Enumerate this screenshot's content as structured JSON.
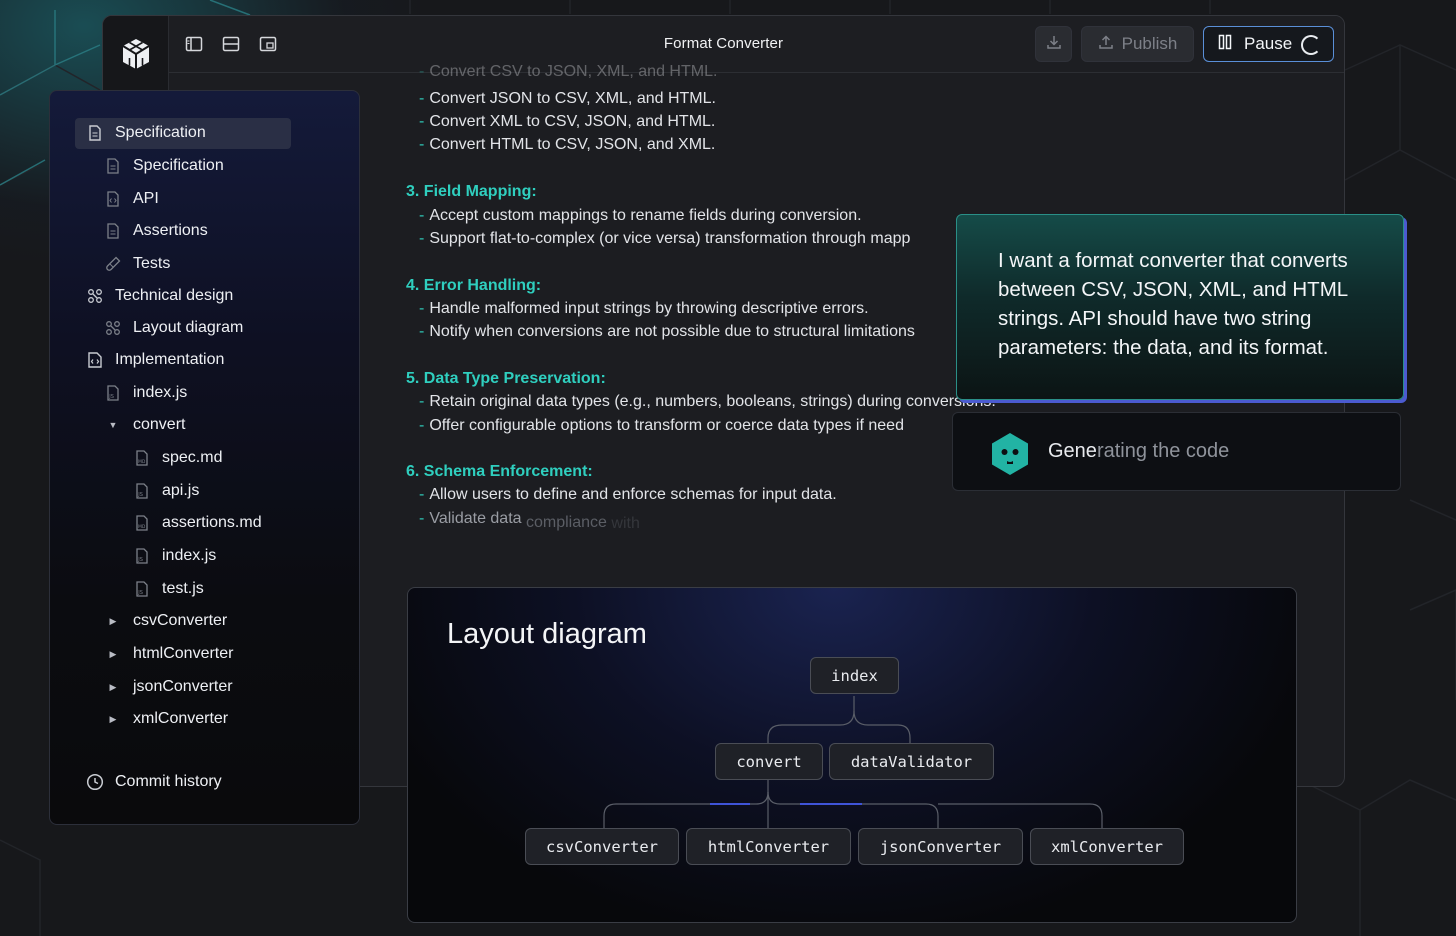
{
  "window": {
    "title": "Format Converter",
    "publish_label": "Publish",
    "pause_label": "Pause"
  },
  "colors": {
    "accent_teal": "#2fc6b6",
    "pause_border": "#5a8fd8",
    "bubble_edge": "#4b5bd0"
  },
  "sidebar": {
    "items": [
      {
        "label": "Specification",
        "icon": "document-icon",
        "active": true
      },
      {
        "label": "Specification",
        "icon": "document-icon"
      },
      {
        "label": "API",
        "icon": "code-file-icon"
      },
      {
        "label": "Assertions",
        "icon": "document-icon"
      },
      {
        "label": "Tests",
        "icon": "flask-icon"
      },
      {
        "label": "Technical design",
        "icon": "diagram-icon"
      },
      {
        "label": "Layout diagram",
        "icon": "diagram-icon"
      },
      {
        "label": "Implementation",
        "icon": "code-file-icon"
      },
      {
        "label": "index.js",
        "icon": "js-file-icon"
      },
      {
        "label": "convert",
        "icon": "caret-down-icon"
      },
      {
        "label": "spec.md",
        "icon": "md-file-icon"
      },
      {
        "label": "api.js",
        "icon": "js-file-icon"
      },
      {
        "label": "assertions.md",
        "icon": "md-file-icon"
      },
      {
        "label": "index.js",
        "icon": "js-file-icon"
      },
      {
        "label": "test.js",
        "icon": "js-file-icon"
      },
      {
        "label": "csvConverter",
        "icon": "caret-right-icon"
      },
      {
        "label": "htmlConverter",
        "icon": "caret-right-icon"
      },
      {
        "label": "jsonConverter",
        "icon": "caret-right-icon"
      },
      {
        "label": "xmlConverter",
        "icon": "caret-right-icon"
      }
    ],
    "commit_history": "Commit history"
  },
  "doc": {
    "lines": [
      "Convert CSV to JSON, XML, and HTML.",
      "Convert JSON to CSV, XML, and HTML.",
      "Convert XML to CSV, JSON, and HTML.",
      "Convert HTML to CSV, JSON, and XML.",
      "3. Field Mapping:",
      "Accept custom mappings to rename fields during conversion.",
      "Support flat-to-complex (or vice versa) transformation through mapp",
      "4. Error Handling:",
      "Handle malformed input strings by throwing descriptive errors.",
      "Notify when conversions are not possible due to structural limitations",
      "5. Data Type Preservation:",
      "Retain original data types (e.g., numbers, booleans, strings) during conversions.",
      "Offer configurable options to transform or coerce data types if need",
      "6. Schema Enforcement:",
      "Allow users to define and enforce schemas for input data.",
      "Validate data",
      "compliance",
      "with"
    ]
  },
  "chat": {
    "message": "I want a format converter that converts between CSV, JSON, XML, and HTML strings. API should have two string parameters: the data, and its format.",
    "status_highlight": "Gene",
    "status_rest": "rating the code"
  },
  "diagram": {
    "title": "Layout diagram",
    "nodes": [
      "index",
      "convert",
      "dataValidator",
      "csvConverter",
      "htmlConverter",
      "jsonConverter",
      "xmlConverter"
    ]
  }
}
